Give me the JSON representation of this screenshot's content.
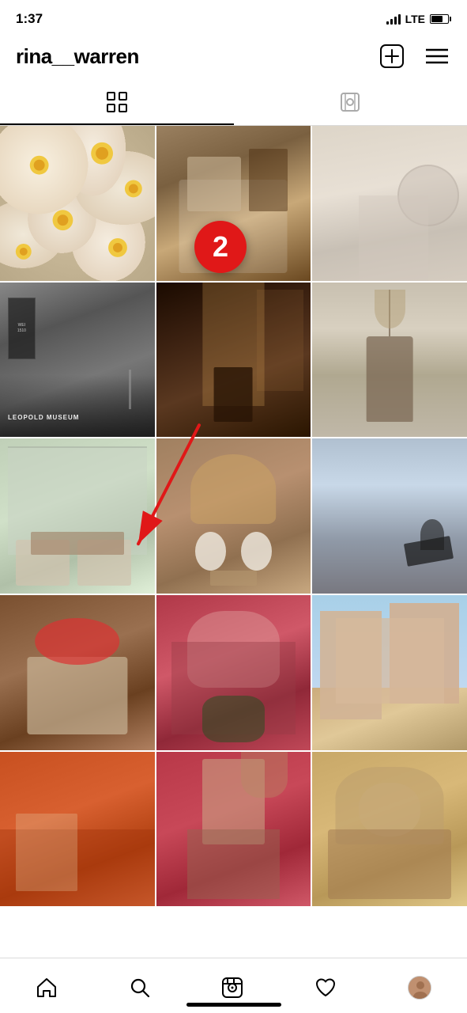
{
  "status": {
    "time": "1:37",
    "lte": "LTE"
  },
  "header": {
    "username": "rina__warren",
    "add_button_label": "Add",
    "menu_button_label": "Menu"
  },
  "tabs": {
    "grid_tab": "Grid",
    "tagged_tab": "Tagged"
  },
  "annotation": {
    "number": "2",
    "arrow_text": "arrow"
  },
  "grid": {
    "cells": [
      {
        "id": 1,
        "type": "daisy",
        "alt": "Daisy flowers"
      },
      {
        "id": 2,
        "type": "cafe",
        "alt": "Cafe with coffee and food"
      },
      {
        "id": 3,
        "type": "room",
        "alt": "Minimalist room with mirror"
      },
      {
        "id": 4,
        "type": "museum",
        "alt": "Leopold Museum exterior"
      },
      {
        "id": 5,
        "type": "dark-cafe",
        "alt": "Dark cafe interior"
      },
      {
        "id": 6,
        "type": "vase",
        "alt": "Dried flowers in vase"
      },
      {
        "id": 7,
        "type": "greenhouse",
        "alt": "Greenhouse interior with sofas"
      },
      {
        "id": 8,
        "type": "hat-picnic",
        "alt": "Hat and coffee picnic"
      },
      {
        "id": 9,
        "type": "ocean",
        "alt": "Person sitting on rocks by ocean"
      },
      {
        "id": 10,
        "type": "strawberry",
        "alt": "Strawberries in bowl on tray"
      },
      {
        "id": 11,
        "type": "flowers-bouquet",
        "alt": "Pink flower bouquet"
      },
      {
        "id": 12,
        "type": "building",
        "alt": "Pink building street"
      },
      {
        "id": 13,
        "type": "orange-fabric",
        "alt": "Orange fabric and book"
      },
      {
        "id": 14,
        "type": "fashion",
        "alt": "Fashion outfit"
      },
      {
        "id": 15,
        "type": "hats-basket",
        "alt": "Straw hats in basket"
      }
    ]
  },
  "nav": {
    "home": "Home",
    "search": "Search",
    "reels": "Reels",
    "likes": "Likes",
    "profile": "Profile"
  }
}
